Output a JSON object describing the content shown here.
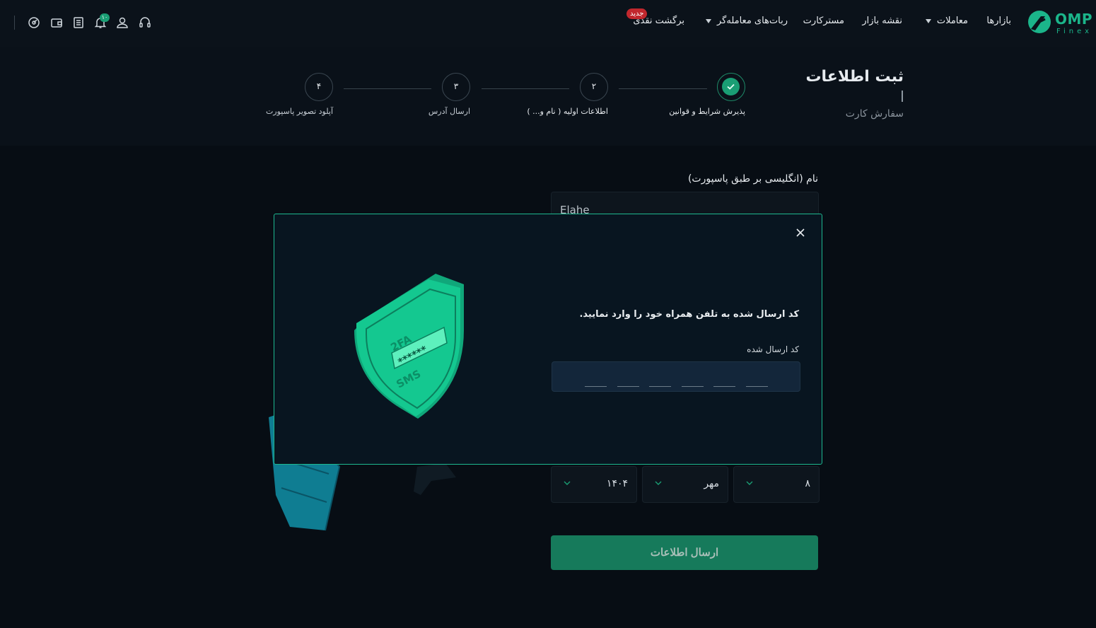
{
  "nav": {
    "logo_text": "OMP",
    "logo_sub": "Finex",
    "markets": "بازارها",
    "trades": "معاملات",
    "market_map": "نقشه بازار",
    "mastercard": "مسترکارت",
    "trader_bots": "ربات‌های معامله‌گر",
    "cashback": "برگشت نقدی",
    "new_badge": "جدید",
    "notification_count": "۱۰",
    "icons": [
      "headset-icon",
      "user-icon",
      "bell-icon",
      "orders-icon",
      "wallet-icon",
      "dashboard-icon"
    ]
  },
  "header": {
    "title": "ثبت اطلاعات",
    "subtitle": "سفارش کارت"
  },
  "steps": [
    {
      "number": "",
      "label": "پذیرش شرایط و قوانین",
      "status": "done"
    },
    {
      "number": "۲",
      "label": "اطلاعات اولیه ( نام و... )",
      "status": "active"
    },
    {
      "number": "۳",
      "label": "ارسال آدرس",
      "status": "pending"
    },
    {
      "number": "۴",
      "label": "آپلود تصویر پاسپورت",
      "status": "pending"
    }
  ],
  "form": {
    "name_label": "نام (انگلیسی بر طبق پاسپورت)",
    "name_value": "Elahe",
    "birth_day": "۸",
    "birth_month": "مهر",
    "birth_year": "۱۴۰۴",
    "submit_label": "ارسال اطلاعات"
  },
  "modal": {
    "message": "کد ارسال شده به تلفن همراه خود را وارد نمایید.",
    "code_label": "کد ارسال شده",
    "otp_length": 6,
    "shield_text_top": "2FA",
    "shield_text_mid": "******",
    "shield_text_bottom": "SMS"
  },
  "colors": {
    "accent": "#1a9e74",
    "modal_border": "#1db890",
    "badge_red": "#c1272d",
    "background": "#070d14"
  }
}
